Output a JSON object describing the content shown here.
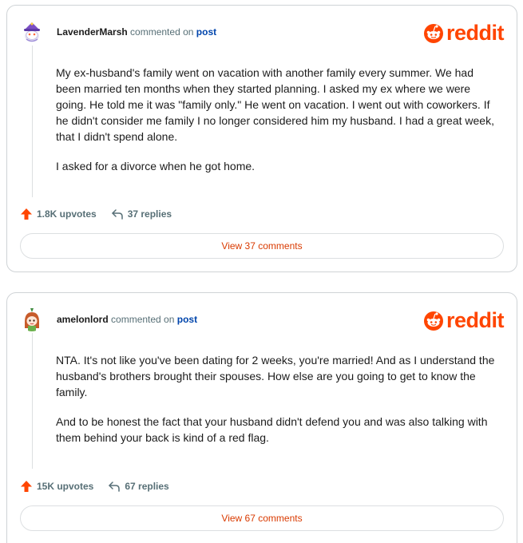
{
  "brand": {
    "name": "reddit",
    "color": "#ff4500"
  },
  "comments": [
    {
      "username": "LavenderMarsh",
      "commented_text": "commented on",
      "post_link": "post",
      "avatar_icon": "snoo-wizard-avatar",
      "paragraphs": [
        "My ex-husband's family went on vacation with another family every summer. We had been married ten months when they started planning. I asked my ex where we were going. He told me it was \"family only.\" He went on vacation. I went out with coworkers. If he didn't consider me family I no longer considered him my husband. I had a great week, that I didn't spend alone.",
        "I asked for a divorce when he got home."
      ],
      "upvotes": "1.8K upvotes",
      "replies": "37 replies",
      "view_button": "View 37 comments"
    },
    {
      "username": "amelonlord",
      "commented_text": "commented on",
      "post_link": "post",
      "avatar_icon": "snoo-redhead-avatar",
      "paragraphs": [
        "NTA. It's not like you've been dating for 2 weeks, you're married! And as I understand the husband's brothers brought their spouses. How else are you going to get to know the family.",
        "And to be honest the fact that your husband didn't defend you and was also talking with them behind your back is kind of a red flag."
      ],
      "upvotes": "15K upvotes",
      "replies": "67 replies",
      "view_button": "View 67 comments"
    }
  ]
}
